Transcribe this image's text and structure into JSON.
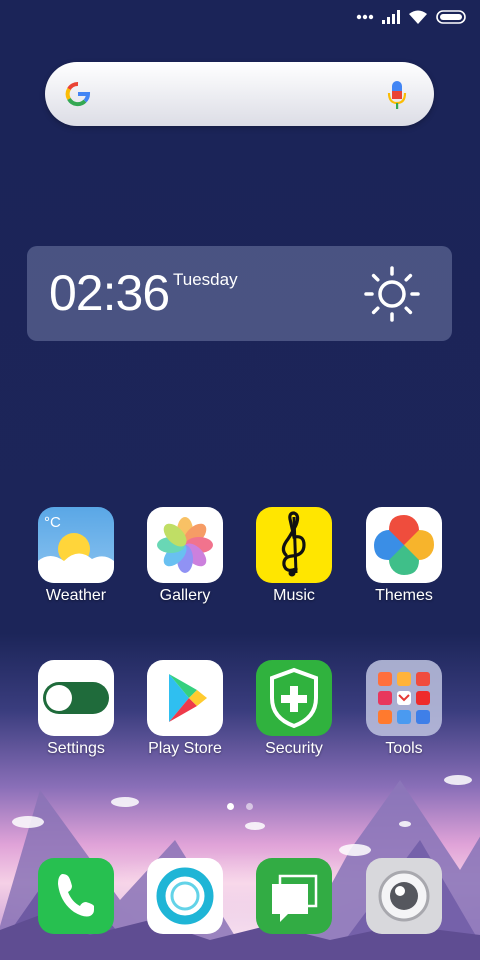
{
  "status_bar": {
    "icons": [
      "dots-icon",
      "signal-icon",
      "wifi-icon",
      "battery-icon"
    ]
  },
  "search_bar": {
    "icons": [
      "google-logo-icon",
      "microphone-icon"
    ]
  },
  "clock_widget": {
    "time": "02:36",
    "day": "Tuesday",
    "weather_icon": "sun-icon"
  },
  "apps": [
    {
      "label": "Weather",
      "icon": "weather-icon"
    },
    {
      "label": "Gallery",
      "icon": "gallery-icon"
    },
    {
      "label": "Music",
      "icon": "music-icon"
    },
    {
      "label": "Themes",
      "icon": "themes-icon"
    },
    {
      "label": "Settings",
      "icon": "settings-icon"
    },
    {
      "label": "Play Store",
      "icon": "play-store-icon"
    },
    {
      "label": "Security",
      "icon": "security-icon"
    },
    {
      "label": "Tools",
      "icon": "tools-folder-icon"
    }
  ],
  "weather_icon_text": "°C",
  "page_indicator": {
    "pages": 2,
    "current": 1
  },
  "dock": [
    {
      "icon": "phone-icon"
    },
    {
      "icon": "browser-icon"
    },
    {
      "icon": "messages-icon"
    },
    {
      "icon": "camera-icon"
    }
  ]
}
